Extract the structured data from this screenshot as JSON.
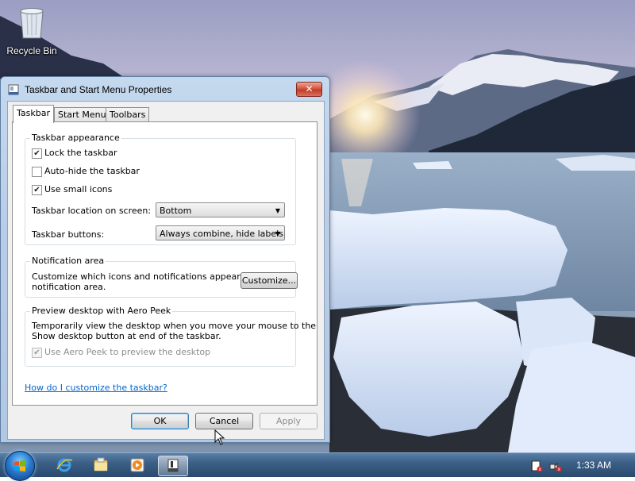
{
  "desktop": {
    "recycle_bin_label": "Recycle Bin"
  },
  "dialog": {
    "title": "Taskbar and Start Menu Properties",
    "close_label": "✕",
    "tabs": [
      {
        "label": "Taskbar",
        "active": true
      },
      {
        "label": "Start Menu",
        "active": false
      },
      {
        "label": "Toolbars",
        "active": false
      }
    ],
    "appearance": {
      "heading": "Taskbar appearance",
      "lock_label": "Lock the taskbar",
      "lock_checked": true,
      "autohide_label": "Auto-hide the taskbar",
      "autohide_checked": false,
      "small_icons_label": "Use small icons",
      "small_icons_checked": true,
      "location_label": "Taskbar location on screen:",
      "location_value": "Bottom",
      "buttons_label": "Taskbar buttons:",
      "buttons_value": "Always combine, hide labels"
    },
    "notification": {
      "heading": "Notification area",
      "text_line1": "Customize which icons and notifications appear in the",
      "text_line2": "notification area.",
      "button": "Customize..."
    },
    "aero_peek": {
      "heading": "Preview desktop with Aero Peek",
      "text_line1": "Temporarily view the desktop when you move your mouse to the",
      "text_line2": "Show desktop button at end of the taskbar.",
      "checkbox_label": "Use Aero Peek to preview the desktop",
      "checkbox_checked": true,
      "checkbox_disabled": true
    },
    "help_link": "How do I customize the taskbar?",
    "buttons": {
      "ok": "OK",
      "cancel": "Cancel",
      "apply": "Apply"
    }
  },
  "taskbar": {
    "pinned": [
      "internet-explorer-icon",
      "windows-explorer-icon",
      "media-player-icon",
      "taskbar-properties-icon"
    ],
    "active_item": "taskbar-properties-icon",
    "clock": "1:33 AM"
  },
  "colors": {
    "link": "#0066cc",
    "close_button": "#c23d27",
    "taskbar": "#3b5f86"
  }
}
